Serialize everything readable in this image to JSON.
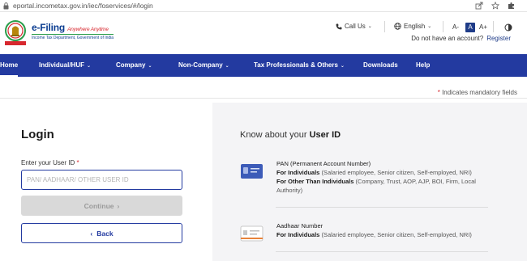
{
  "browser": {
    "url": "eportal.incometax.gov.in/iec/foservices/#/login"
  },
  "header": {
    "brand_title": "e-Filing",
    "brand_tagline": "Anywhere Anytime",
    "brand_sub": "Income Tax Department, Government of India",
    "call_us": "Call Us",
    "language": "English",
    "font_small": "A-",
    "font_normal": "A",
    "font_large": "A+",
    "no_account_text": "Do not have an account?",
    "register_label": "Register"
  },
  "nav": {
    "items": [
      {
        "label": "Home"
      },
      {
        "label": "Individual/HUF"
      },
      {
        "label": "Company"
      },
      {
        "label": "Non-Company"
      },
      {
        "label": "Tax Professionals & Others"
      },
      {
        "label": "Downloads"
      },
      {
        "label": "Help"
      }
    ]
  },
  "mandatory_note": "Indicates mandatory fields",
  "login": {
    "title": "Login",
    "field_label": "Enter your User ID",
    "placeholder": "PAN/ AADHAAR/ OTHER USER ID",
    "continue_label": "Continue",
    "back_label": "Back"
  },
  "info": {
    "heading_prefix": "Know about your",
    "heading_bold": "User ID",
    "pan": {
      "title": "PAN (Permanent Account Number)",
      "individuals_label": "For Individuals",
      "individuals_text": "(Salaried employee, Senior citizen, Self-employed, NRI)",
      "others_label": "For Other Than Individuals",
      "others_text": "(Company, Trust, AOP, AJP, BOI, Firm, Local Authority)"
    },
    "aadhaar": {
      "title": "Aadhaar Number",
      "individuals_label": "For Individuals",
      "individuals_text": "(Salaried employee, Senior citizen, Self-employed, NRI)"
    }
  },
  "colors": {
    "nav_bg": "#233aa0",
    "brand_blue": "#0b3d91",
    "accent_red": "#d7282f",
    "panel_bg": "#f4f4f6"
  }
}
